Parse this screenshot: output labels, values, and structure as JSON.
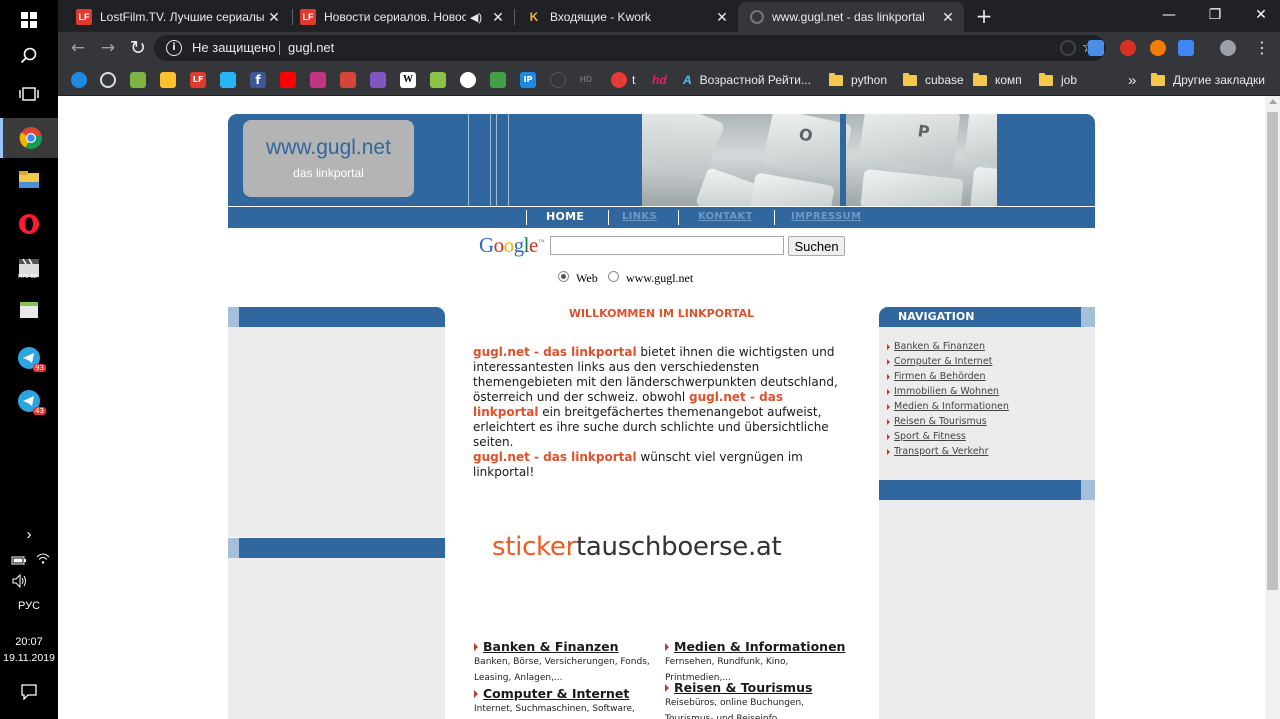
{
  "taskbar": {
    "language": "РУС",
    "time": "20:07",
    "date": "19.11.2019",
    "badge1": "93",
    "badge2": "43",
    "app_label_mpc": "MPC-BE"
  },
  "browser": {
    "tabs": [
      {
        "title": "LostFilm.TV. Лучшие сериалы. С",
        "icon": "lf-icon",
        "fav_text": "LF",
        "close": "✕"
      },
      {
        "title": "Новости сериалов. Новости",
        "icon": "lf-icon",
        "fav_text": "LF",
        "close": "✕"
      },
      {
        "title": "Входящие - Kwork",
        "icon": "kwork-icon",
        "fav_text": "K",
        "close": "✕"
      },
      {
        "title": "www.gugl.net - das linkportal",
        "icon": "loading-icon",
        "fav_text": "",
        "close": "✕"
      }
    ],
    "new_tab": "+",
    "window_controls": [
      "—",
      "❐",
      "✕"
    ],
    "nav": {
      "back": "←",
      "forward": "→",
      "reload": "↻"
    },
    "omnibox": {
      "info": "i",
      "security_label": "Не защищено",
      "url": "gugl.net",
      "star": "☆"
    },
    "bookmarks": {
      "icon_labels": {
        "lf": "LF",
        "facebook": "f",
        "wiki": "W",
        "ip": "IP",
        "hd": "HD",
        "t": "t",
        "hd2": "hd",
        "a": "A"
      },
      "items": [
        {
          "label": "Возрастной Рейти...",
          "icon": "a-icon"
        },
        {
          "label": "python",
          "icon": "folder-icon"
        },
        {
          "label": "cubase",
          "icon": "folder-icon"
        },
        {
          "label": "комп",
          "icon": "folder-icon"
        },
        {
          "label": "job",
          "icon": "folder-icon"
        }
      ],
      "overflow": "»",
      "other": "Другие закладки"
    }
  },
  "site": {
    "logo_main": "www.gugl.net",
    "logo_sub": "das linkportal",
    "keys": [
      "O",
      "P"
    ],
    "menu": [
      {
        "label": "HOME",
        "current": true
      },
      {
        "label": "LINKS",
        "current": false
      },
      {
        "label": "KONTAKT",
        "current": false
      },
      {
        "label": "IMPRESSUM",
        "current": false
      }
    ],
    "search": {
      "logo_letters": [
        {
          "ch": "G",
          "color": "#3366cc"
        },
        {
          "ch": "o",
          "color": "#d62d20"
        },
        {
          "ch": "o",
          "color": "#f0b400"
        },
        {
          "ch": "g",
          "color": "#3366cc"
        },
        {
          "ch": "l",
          "color": "#008744"
        },
        {
          "ch": "e",
          "color": "#d62d20"
        }
      ],
      "tm": "™",
      "input_value": "",
      "button": "Suchen",
      "option_web": "Web",
      "option_site": "www.gugl.net"
    },
    "welcome": "WILLKOMMEN IM LINKPORTAL",
    "intro": {
      "brand": "gugl.net - das linkportal",
      "p1": " bietet ihnen die wichtigsten und interessantesten links aus den verschiedensten themengebieten mit den länderschwerpunkten deutschland, österreich und der schweiz. obwohl ",
      "p2": " ein breitgefächertes themenangebot aufweist, erleichtert es ihre suche durch schlichte und übersichtliche seiten.",
      "p3": " wünscht viel vergnügen im linkportal!"
    },
    "banner": {
      "part1": "sticker",
      "part2": "tauschboerse.at"
    },
    "categories": [
      {
        "title": "Banken & Finanzen",
        "desc": "Banken, Börse, Versicherungen, Fonds, Leasing, Anlagen,..."
      },
      {
        "title": "Medien & Informationen",
        "desc": "Fernsehen, Rundfunk, Kino, Printmedien,..."
      },
      {
        "title": "Computer & Internet",
        "desc": "Internet, Suchmaschinen, Software, Partnerprogramme"
      },
      {
        "title": "Reisen & Tourismus",
        "desc": "Reisebüros, online Buchungen, Tourismus- und Reiseinfo..."
      }
    ],
    "navigation": {
      "title": "NAVIGATION",
      "links": [
        "Banken & Finanzen",
        "Computer & Internet",
        "Firmen & Behörden",
        "Immobilien & Wohnen",
        "Medien & Informationen",
        "Reisen & Tourismus",
        "Sport & Fitness",
        "Transport & Verkehr"
      ]
    }
  }
}
